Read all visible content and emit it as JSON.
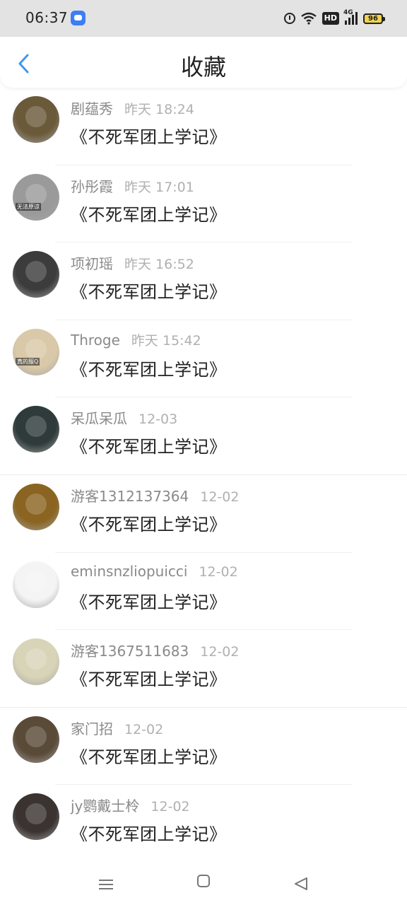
{
  "status_bar": {
    "time": "06:37",
    "network": "4G",
    "hd": "HD",
    "battery": "96"
  },
  "header": {
    "title": "收藏",
    "back_icon": "chevron-left-icon",
    "accent_color": "#3b9af2"
  },
  "items": [
    {
      "user": "剧蕴秀",
      "time": "昨天 18:24",
      "title": "《不死军团上学记》",
      "avatar_color": "#6b5a3a"
    },
    {
      "user": "孙彤霞",
      "time": "昨天 17:01",
      "title": "《不死军团上学记》",
      "avatar_color": "#9a9a9a",
      "avatar_tag": "无法原谅"
    },
    {
      "user": "项初瑶",
      "time": "昨天 16:52",
      "title": "《不死军团上学记》",
      "avatar_color": "#3c3c3c"
    },
    {
      "user": "Throge",
      "time": "昨天 15:42",
      "title": "《不死军团上学记》",
      "avatar_color": "#d9c9a8",
      "avatar_tag": "真的服Q"
    },
    {
      "user": "呆瓜呆瓜",
      "time": "12-03",
      "title": "《不死军团上学记》",
      "avatar_color": "#2f3a3a"
    },
    {
      "user": "游客1312137364",
      "time": "12-02",
      "title": "《不死军团上学记》",
      "avatar_color": "#8a6420"
    },
    {
      "user": "eminsnzliopuicci",
      "time": "12-02",
      "title": "《不死军团上学记》",
      "avatar_color": "#f4f4f4"
    },
    {
      "user": "游客1367511683",
      "time": "12-02",
      "title": "《不死军团上学记》",
      "avatar_color": "#d8d4b8"
    },
    {
      "user": "家门招",
      "time": "12-02",
      "title": "《不死军团上学记》",
      "avatar_color": "#5a4a38"
    },
    {
      "user": "jy鹦戴士柃",
      "time": "12-02",
      "title": "《不死军团上学记》",
      "avatar_color": "#3a3330"
    }
  ],
  "nav_bar": {
    "menu_icon": "menu-icon",
    "home_icon": "home-icon",
    "back_icon": "back-triangle-icon"
  }
}
